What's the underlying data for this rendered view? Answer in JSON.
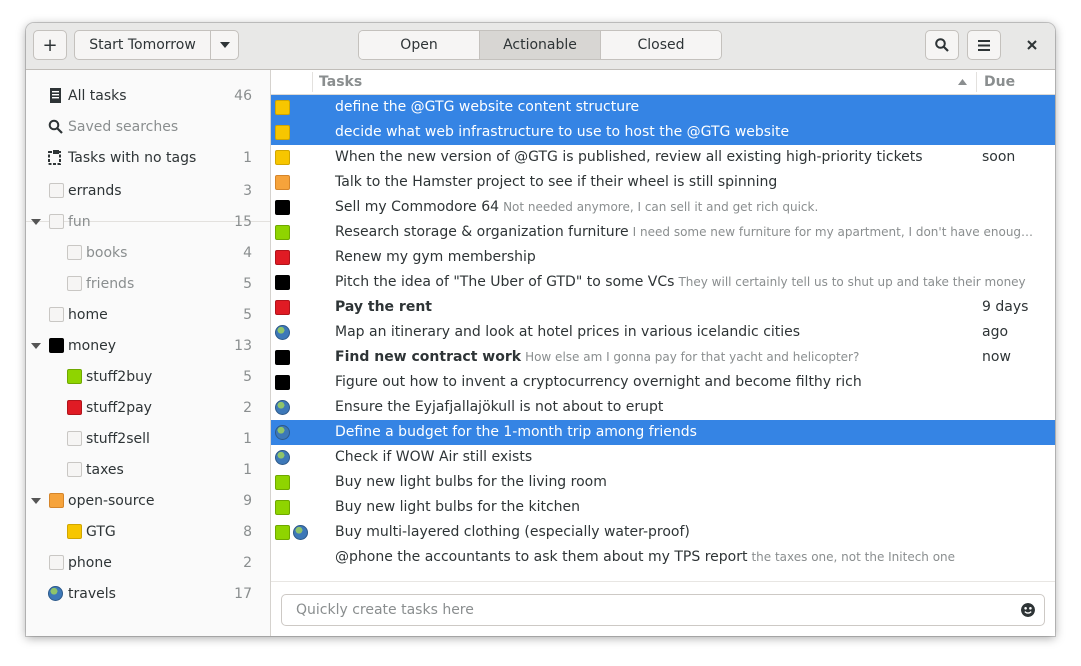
{
  "header": {
    "add_label": "+",
    "start_tomorrow_label": "Start Tomorrow",
    "view_tabs": [
      "Open",
      "Actionable",
      "Closed"
    ],
    "active_tab": "Actionable"
  },
  "sidebar": {
    "items": [
      {
        "label": "All tasks",
        "count": "46",
        "icon": "all-tasks-icon"
      },
      {
        "label": "Saved searches",
        "count": "",
        "icon": "search-icon"
      },
      {
        "label": "Tasks with no tags",
        "count": "1",
        "icon": "no-tags-icon"
      },
      {
        "label": "errands",
        "count": "3",
        "color": ""
      },
      {
        "label": "fun",
        "count": "15",
        "color": ""
      },
      {
        "label": "books",
        "count": "4",
        "color": ""
      },
      {
        "label": "friends",
        "count": "5",
        "color": ""
      },
      {
        "label": "home",
        "count": "5",
        "color": ""
      },
      {
        "label": "money",
        "count": "13",
        "color": "#000000"
      },
      {
        "label": "stuff2buy",
        "count": "5",
        "color": "#8fd400"
      },
      {
        "label": "stuff2pay",
        "count": "2",
        "color": "#e01b24"
      },
      {
        "label": "stuff2sell",
        "count": "1",
        "color": ""
      },
      {
        "label": "taxes",
        "count": "1",
        "color": ""
      },
      {
        "label": "open-source",
        "count": "9",
        "color": "#f6a33b"
      },
      {
        "label": "GTG",
        "count": "8",
        "color": "#f7c600"
      },
      {
        "label": "phone",
        "count": "2",
        "color": ""
      },
      {
        "label": "travels",
        "count": "17",
        "icon": "globe-icon"
      }
    ]
  },
  "tasks": {
    "col_tasks": "Tasks",
    "col_due": "Due",
    "rows": [
      {
        "title": "define the @GTG website content structure",
        "note": "",
        "due": "",
        "bold": false
      },
      {
        "title": "decide what web infrastructure to use to host the @GTG website",
        "note": "",
        "due": "",
        "bold": false
      },
      {
        "title": "When the new version of @GTG is published, review all existing high-priority tickets",
        "note": "",
        "due": "soon",
        "bold": false
      },
      {
        "title": "Talk to the Hamster project to see if their wheel is still spinning",
        "note": "",
        "due": "",
        "bold": false
      },
      {
        "title": "Sell my Commodore 64",
        "note": "Not needed anymore, I can sell it and get rich quick.",
        "due": "",
        "bold": false
      },
      {
        "title": "Research storage & organization furniture",
        "note": "I need some new furniture for my apartment, I don't have enoug…",
        "due": "",
        "bold": false
      },
      {
        "title": "Renew my gym membership",
        "note": "",
        "due": "",
        "bold": false
      },
      {
        "title": "Pitch the idea of \"The Uber of GTD\" to some VCs",
        "note": "They will certainly tell us to shut up and take their money",
        "due": "",
        "bold": false
      },
      {
        "title": "Pay the rent",
        "note": "",
        "due": "9 days ago",
        "bold": true
      },
      {
        "title": "Map an itinerary and look at hotel prices in various icelandic cities",
        "note": "",
        "due": "",
        "bold": false
      },
      {
        "title": "Find new contract work",
        "note": "How else am I gonna pay for that yacht and helicopter?",
        "due": "now",
        "bold": true
      },
      {
        "title": "Figure out how to invent a cryptocurrency overnight and become filthy rich",
        "note": "",
        "due": "",
        "bold": false
      },
      {
        "title": "Ensure the Eyjafjallajökull is not about to erupt",
        "note": "",
        "due": "",
        "bold": false
      },
      {
        "title": "Define a budget for the 1-month trip among friends",
        "note": "",
        "due": "",
        "bold": false
      },
      {
        "title": "Check if WOW Air still exists",
        "note": "",
        "due": "",
        "bold": false
      },
      {
        "title": "Buy new light bulbs for the living room",
        "note": "",
        "due": "",
        "bold": false
      },
      {
        "title": "Buy new light bulbs for the kitchen",
        "note": "",
        "due": "",
        "bold": false
      },
      {
        "title": "Buy multi-layered clothing (especially water-proof)",
        "note": "",
        "due": "",
        "bold": false
      },
      {
        "title": "@phone the accountants to ask them about my TPS report",
        "note": "the taxes one, not the Initech one",
        "due": "",
        "bold": false
      }
    ]
  },
  "quick_add": {
    "placeholder": "Quickly create tasks here"
  },
  "colors": {
    "accent": "#3584e4",
    "selected_text": "#ffffff"
  }
}
